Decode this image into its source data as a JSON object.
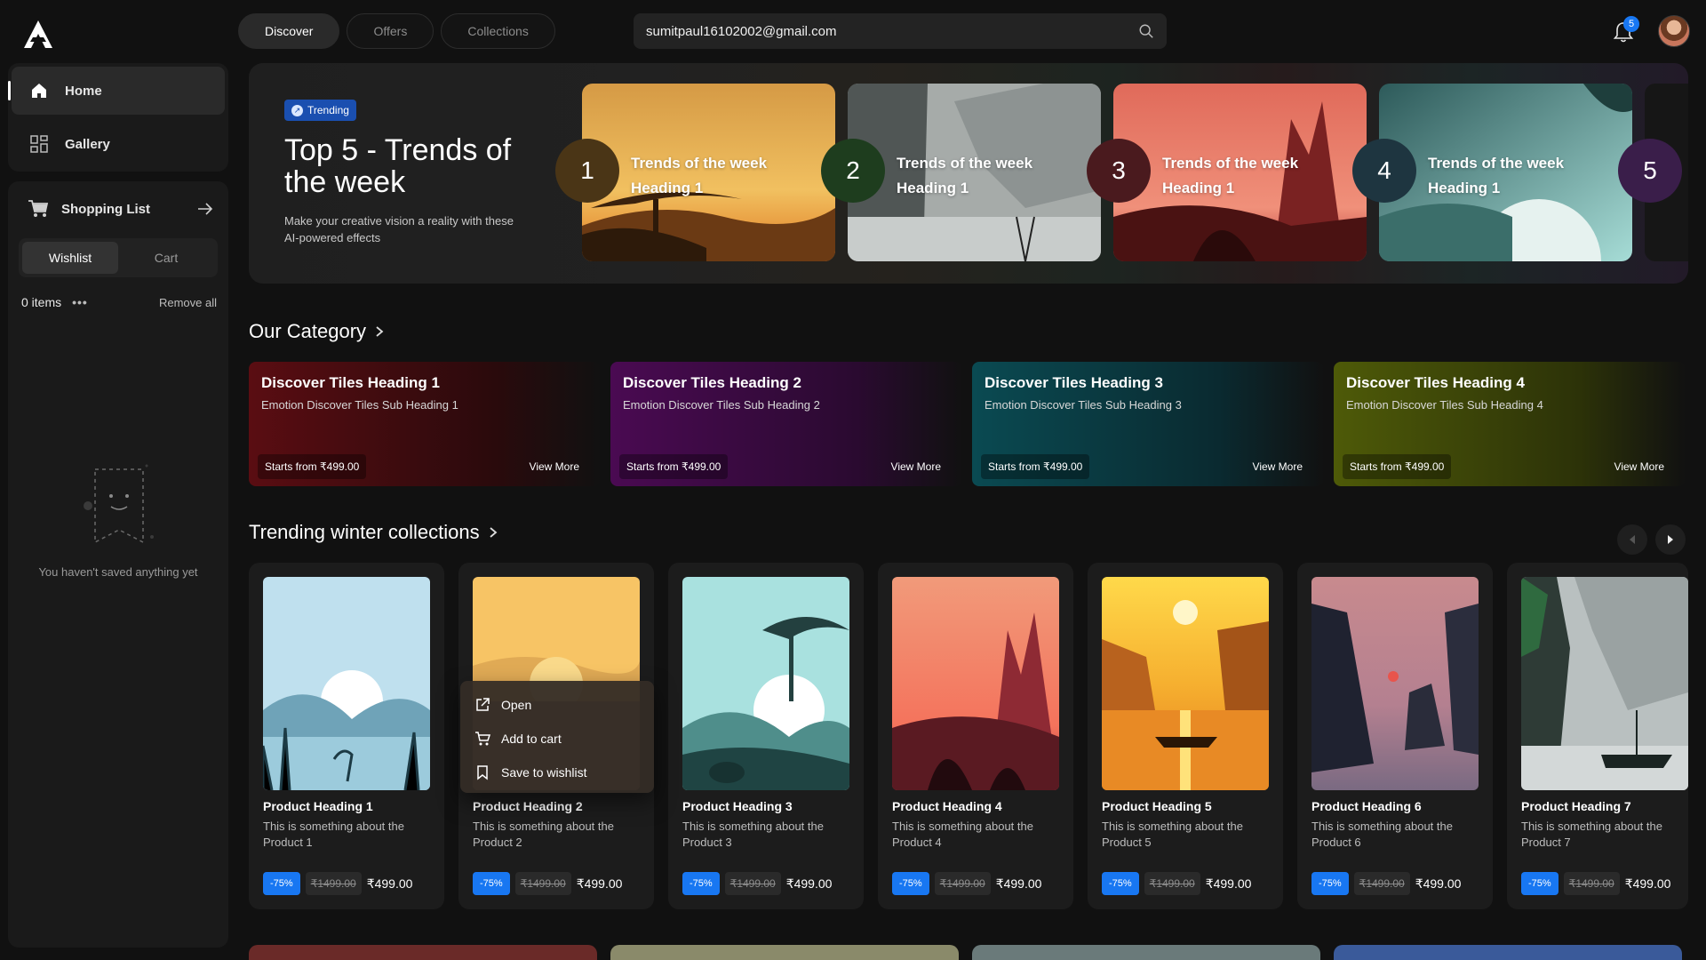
{
  "header": {
    "tabs": [
      {
        "label": "Discover",
        "active": true
      },
      {
        "label": "Offers",
        "active": false
      },
      {
        "label": "Collections",
        "active": false
      }
    ],
    "search_value": "sumitpaul16102002@gmail.com",
    "notification_count": "5"
  },
  "sidebar": {
    "nav": [
      {
        "label": "Home",
        "icon": "home-icon",
        "active": true
      },
      {
        "label": "Gallery",
        "icon": "gallery-icon",
        "active": false
      }
    ],
    "shopping": {
      "title": "Shopping List",
      "tabs": [
        "Wishlist",
        "Cart"
      ],
      "active_tab": "Wishlist",
      "items_count": "0 items",
      "remove_all": "Remove all",
      "empty_text": "You haven't saved anything yet"
    }
  },
  "hero": {
    "badge": "Trending",
    "title": "Top 5 - Trends of the week",
    "subtitle": "Make your creative vision a reality with these AI-powered effects",
    "cards": [
      {
        "num": "1",
        "line1": "Trends of the week",
        "line2": "Heading 1"
      },
      {
        "num": "2",
        "line1": "Trends of the week",
        "line2": "Heading 1"
      },
      {
        "num": "3",
        "line1": "Trends of the week",
        "line2": "Heading 1"
      },
      {
        "num": "4",
        "line1": "Trends of the week",
        "line2": "Heading 1"
      },
      {
        "num": "5"
      }
    ]
  },
  "category": {
    "title": "Our Category",
    "tiles": [
      {
        "heading": "Discover Tiles Heading 1",
        "sub": "Emotion Discover Tiles Sub Heading 1",
        "price": "Starts from ₹499.00",
        "more": "View More",
        "color": "#5a0d12"
      },
      {
        "heading": "Discover Tiles Heading 2",
        "sub": "Emotion Discover Tiles Sub Heading 2",
        "price": "Starts from ₹499.00",
        "more": "View More",
        "color": "#4a0a52"
      },
      {
        "heading": "Discover Tiles Heading 3",
        "sub": "Emotion Discover Tiles Sub Heading 3",
        "price": "Starts from ₹499.00",
        "more": "View More",
        "color": "#0a4a52"
      },
      {
        "heading": "Discover Tiles Heading 4",
        "sub": "Emotion Discover Tiles Sub Heading 4",
        "price": "Starts from ₹499.00",
        "more": "View More",
        "color": "#4e5a08"
      }
    ]
  },
  "winter": {
    "title": "Trending winter collections",
    "products": [
      {
        "heading": "Product Heading 1",
        "desc": "This is something about the Product 1",
        "discount": "-75%",
        "old": "₹1499.00",
        "price": "₹499.00"
      },
      {
        "heading": "Product Heading 2",
        "desc": "This is something about the Product 2",
        "discount": "-75%",
        "old": "₹1499.00",
        "price": "₹499.00"
      },
      {
        "heading": "Product Heading 3",
        "desc": "This is something about the Product 3",
        "discount": "-75%",
        "old": "₹1499.00",
        "price": "₹499.00"
      },
      {
        "heading": "Product Heading 4",
        "desc": "This is something about the Product 4",
        "discount": "-75%",
        "old": "₹1499.00",
        "price": "₹499.00"
      },
      {
        "heading": "Product Heading 5",
        "desc": "This is something about the Product 5",
        "discount": "-75%",
        "old": "₹1499.00",
        "price": "₹499.00"
      },
      {
        "heading": "Product Heading 6",
        "desc": "This is something about the Product 6",
        "discount": "-75%",
        "old": "₹1499.00",
        "price": "₹499.00"
      },
      {
        "heading": "Product Heading 7",
        "desc": "This is something about the Product 7",
        "discount": "-75%",
        "old": "₹1499.00",
        "price": "₹499.00"
      }
    ],
    "context_menu": {
      "items": [
        {
          "label": "Open",
          "icon": "external-link-icon"
        },
        {
          "label": "Add to cart",
          "icon": "cart-icon"
        },
        {
          "label": "Save to wishlist",
          "icon": "bookmark-icon"
        }
      ]
    }
  },
  "colors": {
    "accent": "#1877f2",
    "background": "#111111",
    "panel": "#1a1a1a"
  }
}
